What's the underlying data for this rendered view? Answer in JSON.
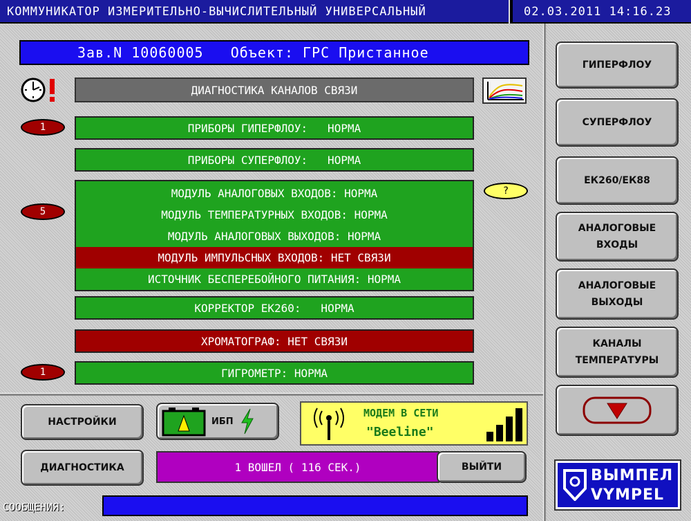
{
  "title_bar": {
    "title": "КОММУНИКАТОР ИЗМЕРИТЕЛЬНО-ВЫЧИСЛИТЕЛЬНЫЙ УНИВЕРСАЛЬНЫЙ",
    "datetime": "02.03.2011 14:16.23"
  },
  "banner": {
    "serial": "Зав.N 10060005",
    "object": "Объект: ГРС Пристанное"
  },
  "diagnostics_header": "ДИАГНОСТИКА КАНАЛОВ СВЯЗИ",
  "status_rows": {
    "hyperflow": "ПРИБОРЫ ГИПЕРФЛОУ:   НОРМА",
    "superflow": "ПРИБОРЫ СУПЕРФЛОУ:   НОРМА",
    "modules": [
      {
        "text": "МОДУЛЬ АНАЛОГОВЫХ ВХОДОВ: НОРМА",
        "state": "ok"
      },
      {
        "text": "МОДУЛЬ ТЕМПЕРАТУРНЫХ ВХОДОВ: НОРМА",
        "state": "ok"
      },
      {
        "text": "МОДУЛЬ АНАЛОГОВЫХ ВЫХОДОВ: НОРМА",
        "state": "ok"
      },
      {
        "text": "МОДУЛЬ ИМПУЛЬСНЫХ ВХОДОВ: НЕТ СВЯЗИ",
        "state": "error"
      },
      {
        "text": "ИСТОЧНИК БЕСПЕРЕБОЙНОГО ПИТАНИЯ: НОРМА",
        "state": "ok"
      }
    ],
    "corrector": "КОРРЕКТОР ЕК260:   НОРМА",
    "chromatograph": "ХРОМАТОГРАФ: НЕТ СВЯЗИ",
    "hygrometer": "ГИГРОМЕТР: НОРМА"
  },
  "badges": {
    "hyperflow_count": "1",
    "modules_count": "5",
    "hygrometer_count": "1",
    "unknown": "?"
  },
  "side_buttons": {
    "hyperflow": "ГИПЕРФЛОУ",
    "superflow": "СУПЕРФЛОУ",
    "ek": "ЕК260/ЕК88",
    "analog_in": "АНАЛОГОВЫЕ\nВХОДЫ",
    "analog_out": "АНАЛОГОВЫЕ\nВЫХОДЫ",
    "temp": "КАНАЛЫ\nТЕМПЕРАТУРЫ"
  },
  "bottom": {
    "settings": "НАСТРОЙКИ",
    "diagnostics": "ДИАГНОСТИКА",
    "ups_label": "ИБП",
    "modem_line1": "МОДЕМ В СЕТИ",
    "modem_line2": "\"Beeline\"",
    "session": "1 ВОШЕЛ ( 116 СЕК.)",
    "logout": "ВЫЙТИ",
    "messages_label": "СООБЩЕНИЯ:",
    "messages_value": ""
  },
  "logo": {
    "line1": "ВЫМПЕЛ",
    "line2": "VYMPEL"
  },
  "colors": {
    "ok": "#1fa31f",
    "error": "#a00000",
    "banner": "#1a0ef0",
    "modem": "#ffff66"
  }
}
